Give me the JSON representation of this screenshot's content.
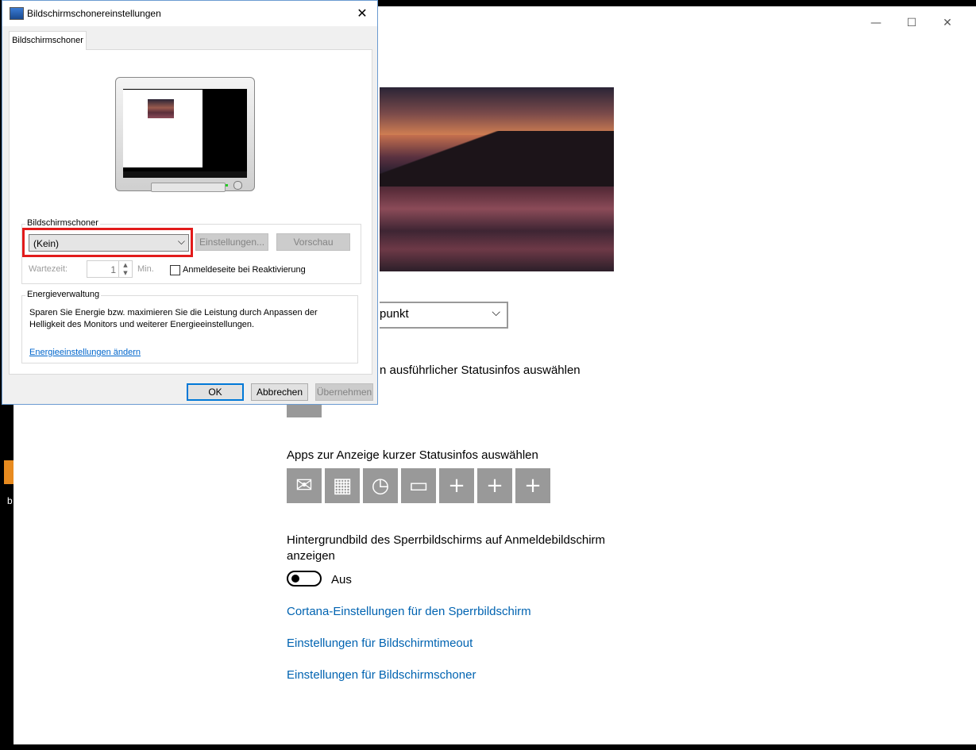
{
  "settings_window": {
    "controls": {
      "minimize": "—",
      "maximize": "☐",
      "close": "✕"
    },
    "dropdown_value_partial": "punkt",
    "detailed_status_label_partial": "n ausführlicher Statusinfos auswählen",
    "quick_status_label": "Apps zur Anzeige kurzer Statusinfos auswählen",
    "quick_status_apps": [
      {
        "icon": "mail-icon",
        "glyph": "✉"
      },
      {
        "icon": "calendar-icon",
        "glyph": "▦"
      },
      {
        "icon": "alarm-clock-icon",
        "glyph": "◷"
      },
      {
        "icon": "message-icon",
        "glyph": "▭"
      },
      {
        "icon": "add-icon",
        "glyph": "+"
      },
      {
        "icon": "add-icon",
        "glyph": "+"
      },
      {
        "icon": "add-icon",
        "glyph": "+"
      }
    ],
    "lockscreen_bg_label": "Hintergrundbild des Sperrbildschirms auf Anmeldebildschirm anzeigen",
    "lockscreen_bg_label_line1": "Hintergrundbild des Sperrbildschirms auf Anmeldebildschirm",
    "lockscreen_bg_label_line2": "anzeigen",
    "toggle_state": "Aus",
    "links": [
      "Cortana-Einstellungen für den Sperrbildschirm",
      "Einstellungen für Bildschirmtimeout",
      "Einstellungen für Bildschirmschoner"
    ]
  },
  "desktop": {
    "icon_label": "b"
  },
  "dialog": {
    "title": "Bildschirmschonereinstellungen",
    "close": "✕",
    "tab": "Bildschirmschoner",
    "screensaver_group": {
      "label": "Bildschirmschoner",
      "selected": "(Kein)",
      "arrow": "⌵",
      "settings_button": "Einstellungen...",
      "preview_button": "Vorschau",
      "wait_label": "Wartezeit:",
      "wait_value": "1",
      "wait_unit": "Min.",
      "spin_up": "▲",
      "spin_down": "▼",
      "resume_checkbox_label": "Anmeldeseite bei Reaktivierung",
      "resume_checked": false
    },
    "energy_group": {
      "label": "Energieverwaltung",
      "description": "Sparen Sie Energie bzw. maximieren Sie die Leistung durch Anpassen der Helligkeit des Monitors und weiterer Energieeinstellungen.",
      "link": "Energieeinstellungen ändern"
    },
    "buttons": {
      "ok": "OK",
      "cancel": "Abbrechen",
      "apply": "Übernehmen"
    }
  },
  "colors": {
    "highlight": "#e21b1b",
    "link": "#0063b1",
    "tile": "#999999"
  }
}
